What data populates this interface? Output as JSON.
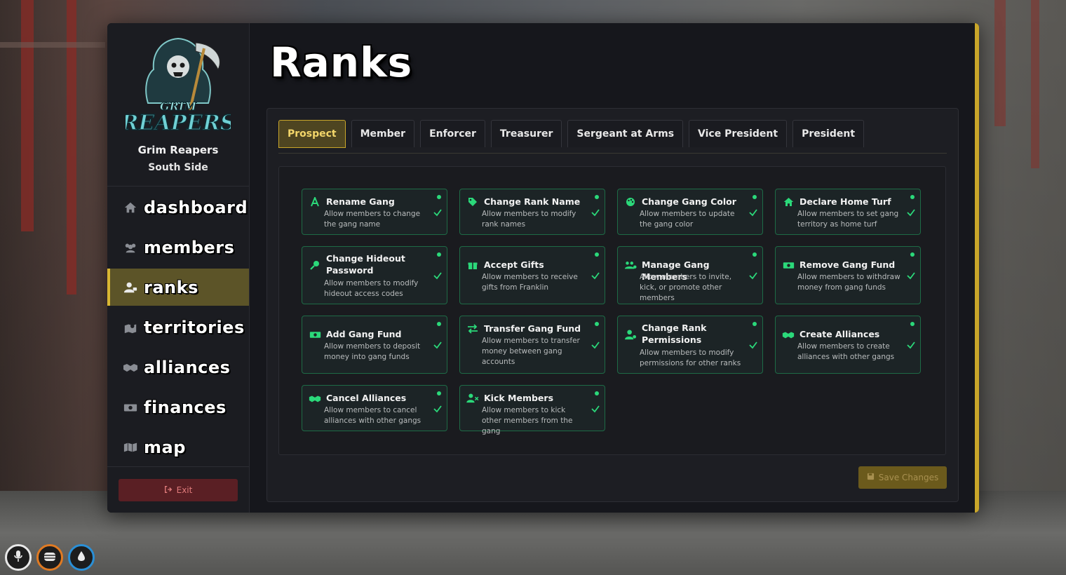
{
  "sidebar": {
    "gang_name": "Grim Reapers",
    "gang_subtitle": "South Side",
    "nav": [
      {
        "label": "dashboard",
        "icon": "home-icon",
        "active": false
      },
      {
        "label": "members",
        "icon": "users-icon",
        "active": false
      },
      {
        "label": "ranks",
        "icon": "user-icon",
        "active": true
      },
      {
        "label": "territories",
        "icon": "map-marker-icon",
        "active": false
      },
      {
        "label": "alliances",
        "icon": "handshake-icon",
        "active": false
      },
      {
        "label": "finances",
        "icon": "money-icon",
        "active": false
      },
      {
        "label": "map",
        "icon": "map-icon",
        "active": false
      }
    ],
    "exit_label": "Exit"
  },
  "page_title": "Ranks",
  "tabs": [
    {
      "label": "Prospect",
      "active": true
    },
    {
      "label": "Member",
      "active": false
    },
    {
      "label": "Enforcer",
      "active": false
    },
    {
      "label": "Treasurer",
      "active": false
    },
    {
      "label": "Sergeant at Arms",
      "active": false
    },
    {
      "label": "Vice President",
      "active": false
    },
    {
      "label": "President",
      "active": false
    }
  ],
  "permissions": [
    {
      "title": "Rename Gang",
      "desc": "Allow members to change the gang name",
      "icon": "font-icon",
      "enabled": true
    },
    {
      "title": "Change Rank Name",
      "desc": "Allow members to modify rank names",
      "icon": "tag-icon",
      "enabled": true
    },
    {
      "title": "Change Gang Color",
      "desc": "Allow members to update the gang color",
      "icon": "palette-icon",
      "enabled": true
    },
    {
      "title": "Declare Home Turf",
      "desc": "Allow members to set gang territory as home turf",
      "icon": "home-icon",
      "enabled": true
    },
    {
      "title": "Change Hideout Password",
      "desc": "Allow members to modify hideout access codes",
      "icon": "key-icon",
      "enabled": true
    },
    {
      "title": "Accept Gifts",
      "desc": "Allow members to receive gifts from Franklin",
      "icon": "gift-icon",
      "enabled": true
    },
    {
      "title": "Manage Gang Members",
      "desc": "Allow members to invite, kick, or promote other members",
      "icon": "users-cog-icon",
      "enabled": true
    },
    {
      "title": "Remove Gang Fund",
      "desc": "Allow members to withdraw money from gang funds",
      "icon": "money-icon",
      "enabled": true
    },
    {
      "title": "Add Gang Fund",
      "desc": "Allow members to deposit money into gang funds",
      "icon": "money-icon",
      "enabled": true
    },
    {
      "title": "Transfer Gang Fund",
      "desc": "Allow members to transfer money between gang accounts",
      "icon": "exchange-icon",
      "enabled": true
    },
    {
      "title": "Change Rank Permissions",
      "desc": "Allow members to modify permissions for other ranks",
      "icon": "user-cog-icon",
      "enabled": true
    },
    {
      "title": "Create Alliances",
      "desc": "Allow members to create alliances with other gangs",
      "icon": "handshake-icon",
      "enabled": true
    },
    {
      "title": "Cancel Alliances",
      "desc": "Allow members to cancel alliances with other gangs",
      "icon": "handshake-slash-icon",
      "enabled": true
    },
    {
      "title": "Kick Members",
      "desc": "Allow members to kick other members from the gang",
      "icon": "user-times-icon",
      "enabled": true
    }
  ],
  "save_label": "Save Changes",
  "colors": {
    "accent_gold": "#c9a62a",
    "success_green": "#2bd97a",
    "panel_bg": "#16171c",
    "exit_red": "#5a1f24"
  },
  "hud": [
    {
      "icon": "microphone-icon",
      "ring": "#e8e8e8"
    },
    {
      "icon": "armor-icon",
      "ring": "#e07a22"
    },
    {
      "icon": "water-drop-icon",
      "ring": "#2a8fd6"
    }
  ]
}
